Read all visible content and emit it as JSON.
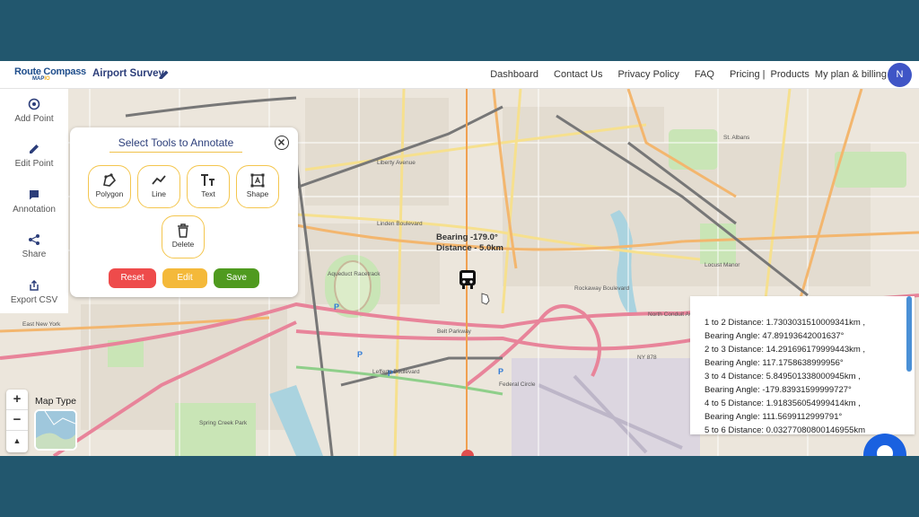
{
  "header": {
    "logo_top": "Route Compass",
    "logo_bottom_a": "MAP",
    "logo_bottom_b": "IO",
    "project_title": "Airport Survey",
    "nav": [
      "Dashboard",
      "Contact Us",
      "Privacy Policy",
      "FAQ",
      "Pricing |",
      "Products",
      "My plan & billing"
    ],
    "avatar_initial": "N"
  },
  "sidebar": {
    "items": [
      {
        "label": "Add Point",
        "icon": "add-point-icon"
      },
      {
        "label": "Edit Point",
        "icon": "pencil-icon"
      },
      {
        "label": "Annotation",
        "icon": "comment-icon"
      },
      {
        "label": "Share",
        "icon": "share-icon"
      },
      {
        "label": "Export CSV",
        "icon": "export-icon"
      }
    ]
  },
  "annotate_panel": {
    "title": "Select Tools to Annotate",
    "tools": [
      {
        "label": "Polygon",
        "icon": "polygon-icon"
      },
      {
        "label": "Line",
        "icon": "line-icon"
      },
      {
        "label": "Text",
        "icon": "text-icon"
      },
      {
        "label": "Shape",
        "icon": "shape-icon"
      },
      {
        "label": "Delete",
        "icon": "trash-icon"
      }
    ],
    "buttons": {
      "reset": "Reset",
      "edit": "Edit",
      "save": "Save"
    },
    "colors": {
      "reset": "#ee4b4b",
      "edit": "#f4b93a",
      "save": "#4f9a1f",
      "tool_border": "#f4c64e"
    }
  },
  "map": {
    "bearing_label": "Bearing -179.0°",
    "distance_label": "Distance - 5.0km",
    "map_type_label": "Map Type",
    "zoom_in": "+",
    "zoom_out": "−",
    "compass": "▲",
    "place_labels": [
      "Aqueduct Racetrack",
      "East New York",
      "Lefferts Boulevard",
      "Federal Circle",
      "Spring Creek Park",
      "Locust Manor",
      "St. Albans",
      "North Conduit Avenue",
      "Belt Parkway",
      "NY 878",
      "Linden Boulevard",
      "Liberty Avenue",
      "Rockaway Boulevard"
    ]
  },
  "distances": [
    "1 to 2 Distance: 1.7303031510009341km ,",
    "Bearing Angle: 47.89193642001637°",
    "2 to 3 Distance: 14.291696179999443km ,",
    "Bearing Angle: 117.1758638999956°",
    "3 to 4 Distance: 5.849501338000945km ,",
    "Bearing Angle: -179.83931599999727°",
    "4 to 5 Distance: 1.918356054999414km ,",
    "Bearing Angle: 111.5699112999791°",
    "5 to 6 Distance: 0.03277080800146955km"
  ],
  "colors": {
    "background": "#22576e",
    "accent": "#3f55c6",
    "route_line": "#f0a050"
  }
}
